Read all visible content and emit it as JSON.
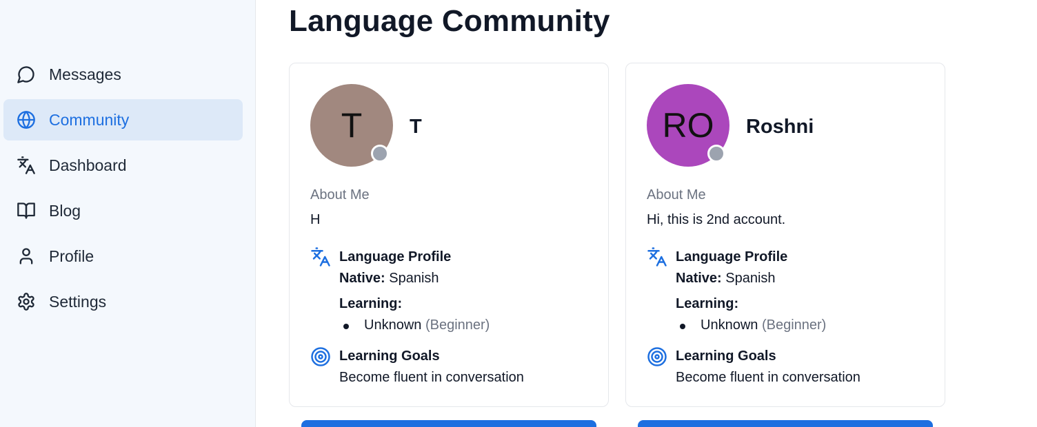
{
  "colors": {
    "accent": "#1d6fe0",
    "sidebar_bg": "#f4f8fd",
    "active_bg": "#dde9f8",
    "offline": "#9ca3af"
  },
  "sidebar": {
    "items": [
      {
        "label": "Messages",
        "icon": "message-circle-icon",
        "active": false
      },
      {
        "label": "Community",
        "icon": "globe-icon",
        "active": true
      },
      {
        "label": "Dashboard",
        "icon": "translate-icon",
        "active": false
      },
      {
        "label": "Blog",
        "icon": "book-open-icon",
        "active": false
      },
      {
        "label": "Profile",
        "icon": "user-icon",
        "active": false
      },
      {
        "label": "Settings",
        "icon": "gear-icon",
        "active": false
      }
    ]
  },
  "main": {
    "title": "Language Community",
    "cards": [
      {
        "initials": "T",
        "avatar_color": "#a1887f",
        "name": "T",
        "about_heading": "About Me",
        "about": "H",
        "language_profile_title": "Language Profile",
        "native_label": "Native:",
        "native_value": "Spanish",
        "learning_label": "Learning:",
        "learning": [
          {
            "language": "Unknown",
            "level": "(Beginner)"
          }
        ],
        "goals_title": "Learning Goals",
        "goals": "Become fluent in conversation"
      },
      {
        "initials": "RO",
        "avatar_color": "#ab47bc",
        "name": "Roshni",
        "about_heading": "About Me",
        "about": "Hi, this is 2nd account.",
        "language_profile_title": "Language Profile",
        "native_label": "Native:",
        "native_value": "Spanish",
        "learning_label": "Learning:",
        "learning": [
          {
            "language": "Unknown",
            "level": "(Beginner)"
          }
        ],
        "goals_title": "Learning Goals",
        "goals": "Become fluent in conversation"
      }
    ]
  }
}
